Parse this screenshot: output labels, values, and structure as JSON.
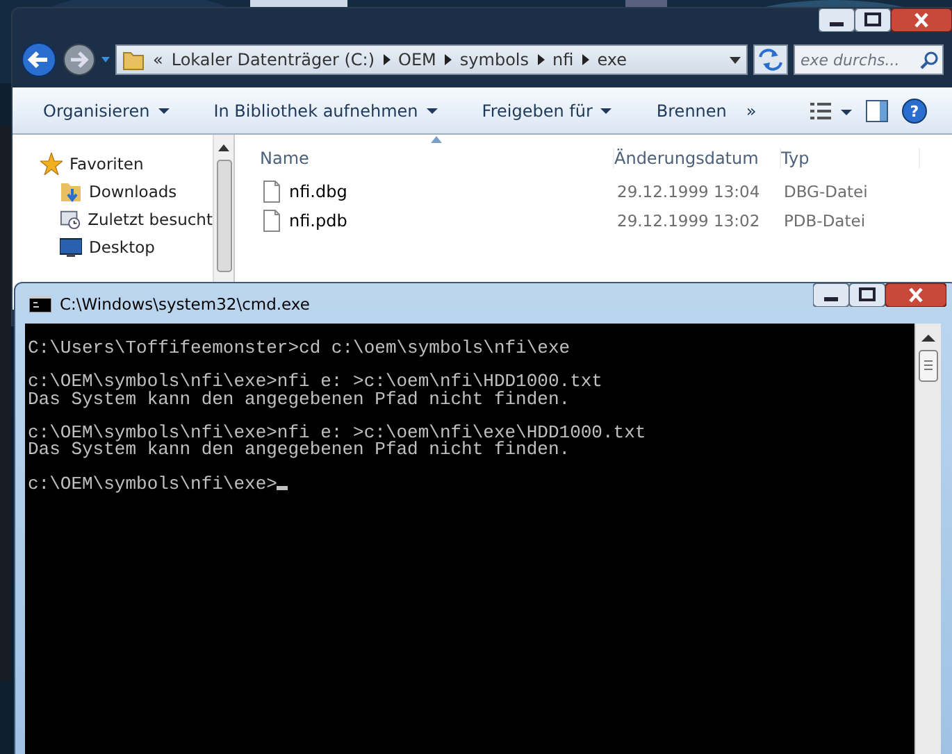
{
  "explorer": {
    "breadcrumb": [
      "«",
      "Lokaler Datenträger (C:)",
      "OEM",
      "symbols",
      "nfi",
      "exe"
    ],
    "search": {
      "placeholder": "exe durchs..."
    },
    "toolbar": [
      {
        "label": "Organisieren",
        "has_menu": true
      },
      {
        "label": "In Bibliothek aufnehmen",
        "has_menu": true
      },
      {
        "label": "Freigeben für",
        "has_menu": true
      },
      {
        "label": "Brennen",
        "has_menu": false
      }
    ],
    "toolbar_more": "»",
    "help": "?",
    "sidebar": {
      "items": [
        {
          "label": "Favoriten",
          "kind": "star"
        },
        {
          "label": "Downloads",
          "kind": "downloads"
        },
        {
          "label": "Zuletzt besucht",
          "kind": "recent"
        },
        {
          "label": "Desktop",
          "kind": "desktop"
        }
      ]
    },
    "table": {
      "columns": [
        "Name",
        "Änderungsdatum",
        "Typ"
      ],
      "rows": [
        {
          "name": "nfi.dbg",
          "date": "29.12.1999 13:04",
          "type": "DBG-Datei"
        },
        {
          "name": "nfi.pdb",
          "date": "29.12.1999 13:02",
          "type": "PDB-Datei"
        }
      ]
    }
  },
  "console": {
    "title": "C:\\Windows\\system32\\cmd.exe",
    "blocks": [
      [
        "C:\\Users\\Toffifeemonster>cd c:\\oem\\symbols\\nfi\\exe"
      ],
      [
        "c:\\OEM\\symbols\\nfi\\exe>nfi e: >c:\\oem\\nfi\\HDD1000.txt",
        "Das System kann den angegebenen Pfad nicht finden."
      ],
      [
        "c:\\OEM\\symbols\\nfi\\exe>nfi e: >c:\\oem\\nfi\\exe\\HDD1000.txt",
        "Das System kann den angegebenen Pfad nicht finden."
      ],
      [
        "c:\\OEM\\symbols\\nfi\\exe>"
      ]
    ],
    "cursor": true
  }
}
